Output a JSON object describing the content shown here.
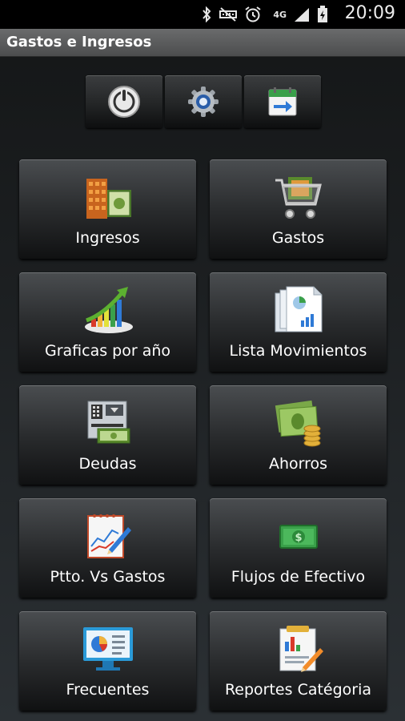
{
  "status_bar": {
    "time": "20:09",
    "network": "4G",
    "icons": [
      "bluetooth-icon",
      "mute-icon",
      "alarm-icon",
      "network-4g-icon",
      "signal-icon",
      "battery-icon"
    ]
  },
  "title_bar": {
    "title": "Gastos e Ingresos"
  },
  "toolbar": {
    "buttons": [
      {
        "icon": "power-icon"
      },
      {
        "icon": "settings-gear-icon"
      },
      {
        "icon": "calendar-arrow-icon"
      }
    ]
  },
  "tiles": [
    {
      "label": "Ingresos",
      "icon": "money-stack-icon"
    },
    {
      "label": "Gastos",
      "icon": "shopping-cart-icon"
    },
    {
      "label": "Graficas por año",
      "icon": "bar-chart-arrow-icon"
    },
    {
      "label": "Lista Movimientos",
      "icon": "documents-icon"
    },
    {
      "label": "Deudas",
      "icon": "atm-icon"
    },
    {
      "label": "Ahorros",
      "icon": "cash-coins-icon"
    },
    {
      "label": "Ptto. Vs Gastos",
      "icon": "notepad-pen-icon"
    },
    {
      "label": "Flujos de Efectivo",
      "icon": "dollar-bill-icon"
    },
    {
      "label": "Frecuentes",
      "icon": "monitor-chart-icon"
    },
    {
      "label": "Reportes Catégoria",
      "icon": "report-pen-icon"
    }
  ],
  "colors": {
    "background": "#1c1f21",
    "title_bar": "#5b5c5d",
    "tile_top": "#4a4d50",
    "tile_bottom": "#101112"
  }
}
